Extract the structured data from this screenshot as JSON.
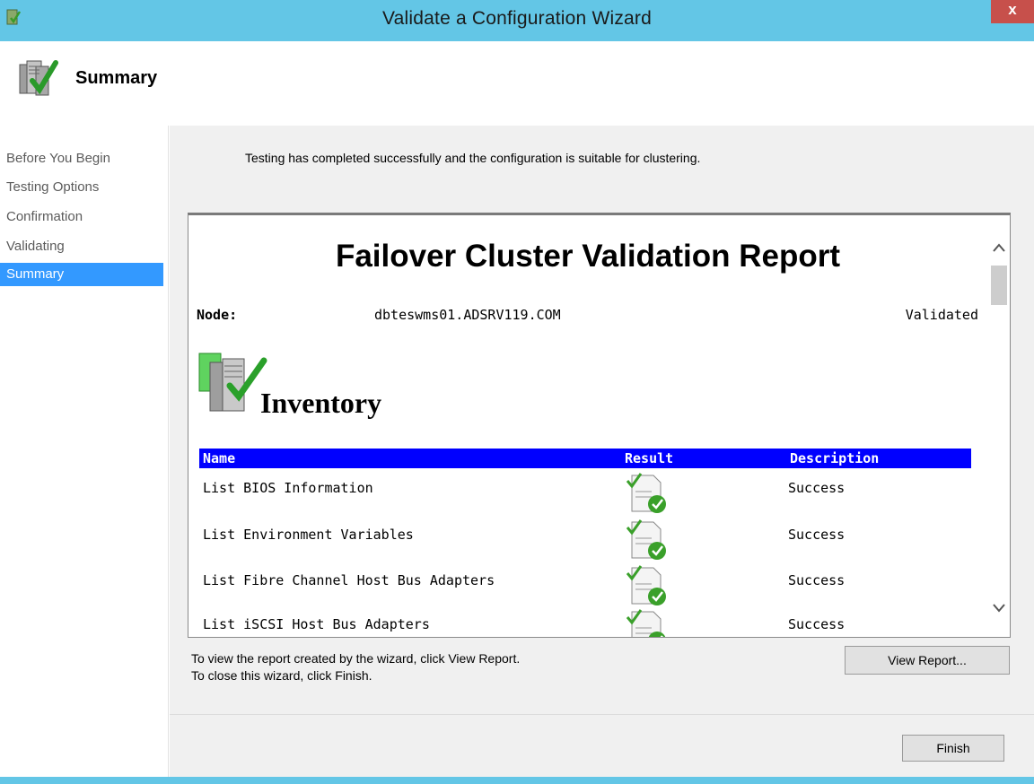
{
  "window": {
    "title": "Validate a Configuration Wizard",
    "close_label": "x",
    "accent_color": "#63c6e6"
  },
  "header": {
    "title": "Summary",
    "icon": "server-check-icon"
  },
  "sidebar": {
    "items": [
      {
        "label": "Before You Begin",
        "active": false
      },
      {
        "label": "Testing Options",
        "active": false
      },
      {
        "label": "Confirmation",
        "active": false
      },
      {
        "label": "Validating",
        "active": false
      },
      {
        "label": "Summary",
        "active": true
      }
    ]
  },
  "main": {
    "status_message": "Testing has completed successfully and the configuration is suitable for clustering.",
    "report": {
      "title": "Failover Cluster Validation Report",
      "node_label": "Node:",
      "node_value": "dbteswms01.ADSRV119.COM",
      "node_status": "Validated",
      "section_title": "Inventory",
      "columns": {
        "name": "Name",
        "result": "Result",
        "description": "Description"
      },
      "rows": [
        {
          "name": "List BIOS Information",
          "result_icon": "success-check-icon",
          "description": "Success"
        },
        {
          "name": "List Environment Variables",
          "result_icon": "success-check-icon",
          "description": "Success"
        },
        {
          "name": "List Fibre Channel Host Bus Adapters",
          "result_icon": "success-check-icon",
          "description": "Success"
        },
        {
          "name": "List iSCSI Host Bus Adapters",
          "result_icon": "success-check-icon",
          "description": "Success"
        }
      ]
    },
    "hint_view": "To view the report created by the wizard, click View Report.",
    "hint_close": "To close this wizard, click Finish.",
    "view_report_label": "View Report..."
  },
  "footer": {
    "finish_label": "Finish"
  }
}
